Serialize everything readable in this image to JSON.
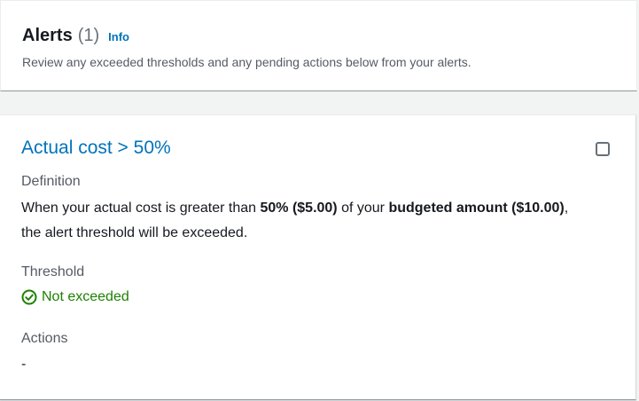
{
  "header": {
    "title": "Alerts",
    "count": "(1)",
    "info_link": "Info",
    "description": "Review any exceeded thresholds and any pending actions below from your alerts."
  },
  "alert": {
    "title": "Actual cost > 50%",
    "checked": false,
    "definition": {
      "label": "Definition",
      "text_1": "When your actual cost is greater than ",
      "bold_1": "50% ($5.00)",
      "text_2": " of your ",
      "bold_2": "budgeted amount ($10.00)",
      "text_3": ", the alert threshold will be exceeded."
    },
    "threshold": {
      "label": "Threshold",
      "status": "Not exceeded",
      "status_color": "#1d8102",
      "status_icon": "check-circle-icon"
    },
    "actions": {
      "label": "Actions",
      "value": "-"
    }
  },
  "colors": {
    "link": "#0073bb",
    "text": "#16191f",
    "secondary_text": "#545b64",
    "success": "#1d8102",
    "background": "#f2f3f3"
  }
}
